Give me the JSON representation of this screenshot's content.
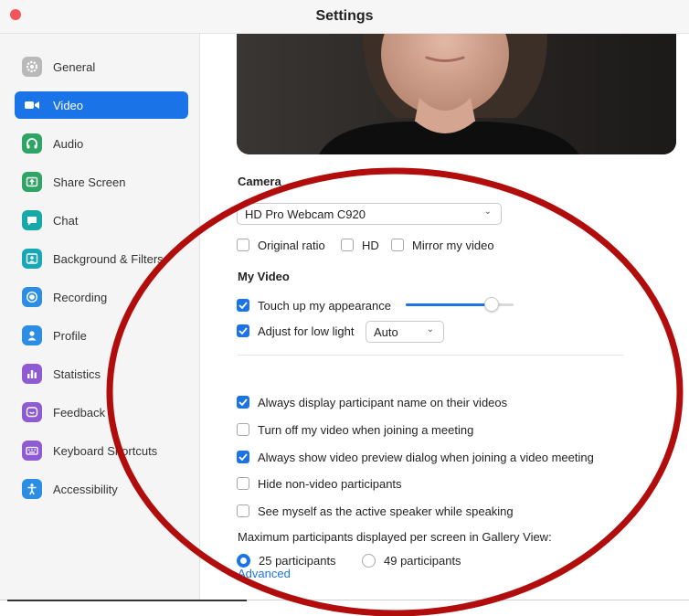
{
  "window": {
    "title": "Settings"
  },
  "colors": {
    "accent": "#1a74e8",
    "annotation": "#b10d0d"
  },
  "sidebar": {
    "items": [
      {
        "label": "General",
        "icon": "gear-icon",
        "active": false
      },
      {
        "label": "Video",
        "icon": "video-camera-icon",
        "active": true
      },
      {
        "label": "Audio",
        "icon": "headphones-icon",
        "active": false
      },
      {
        "label": "Share Screen",
        "icon": "share-screen-icon",
        "active": false
      },
      {
        "label": "Chat",
        "icon": "chat-bubble-icon",
        "active": false
      },
      {
        "label": "Background & Filters",
        "icon": "portrait-icon",
        "active": false
      },
      {
        "label": "Recording",
        "icon": "record-icon",
        "active": false
      },
      {
        "label": "Profile",
        "icon": "person-icon",
        "active": false
      },
      {
        "label": "Statistics",
        "icon": "bar-chart-icon",
        "active": false
      },
      {
        "label": "Feedback",
        "icon": "smiley-icon",
        "active": false
      },
      {
        "label": "Keyboard Shortcuts",
        "icon": "keyboard-icon",
        "active": false
      },
      {
        "label": "Accessibility",
        "icon": "accessibility-icon",
        "active": false
      }
    ]
  },
  "camera": {
    "section_label": "Camera",
    "selected_device": "HD Pro Webcam C920",
    "options": [
      {
        "label": "Original ratio",
        "checked": false
      },
      {
        "label": "HD",
        "checked": false
      },
      {
        "label": "Mirror my video",
        "checked": false
      }
    ]
  },
  "my_video": {
    "section_label": "My Video",
    "touch_up": {
      "label": "Touch up my appearance",
      "checked": true,
      "level": 0.8
    },
    "low_light": {
      "label": "Adjust for low light",
      "checked": true,
      "mode": "Auto"
    }
  },
  "general_options": [
    {
      "label": "Always display participant name on their videos",
      "checked": true
    },
    {
      "label": "Turn off my video when joining a meeting",
      "checked": false
    },
    {
      "label": "Always show video preview dialog when joining a video meeting",
      "checked": true
    },
    {
      "label": "Hide non-video participants",
      "checked": false
    },
    {
      "label": "See myself as the active speaker while speaking",
      "checked": false
    }
  ],
  "gallery": {
    "label": "Maximum participants displayed per screen in Gallery View:",
    "options": [
      {
        "label": "25 participants",
        "selected": true
      },
      {
        "label": "49 participants",
        "selected": false
      }
    ]
  },
  "advanced_link": "Advanced"
}
